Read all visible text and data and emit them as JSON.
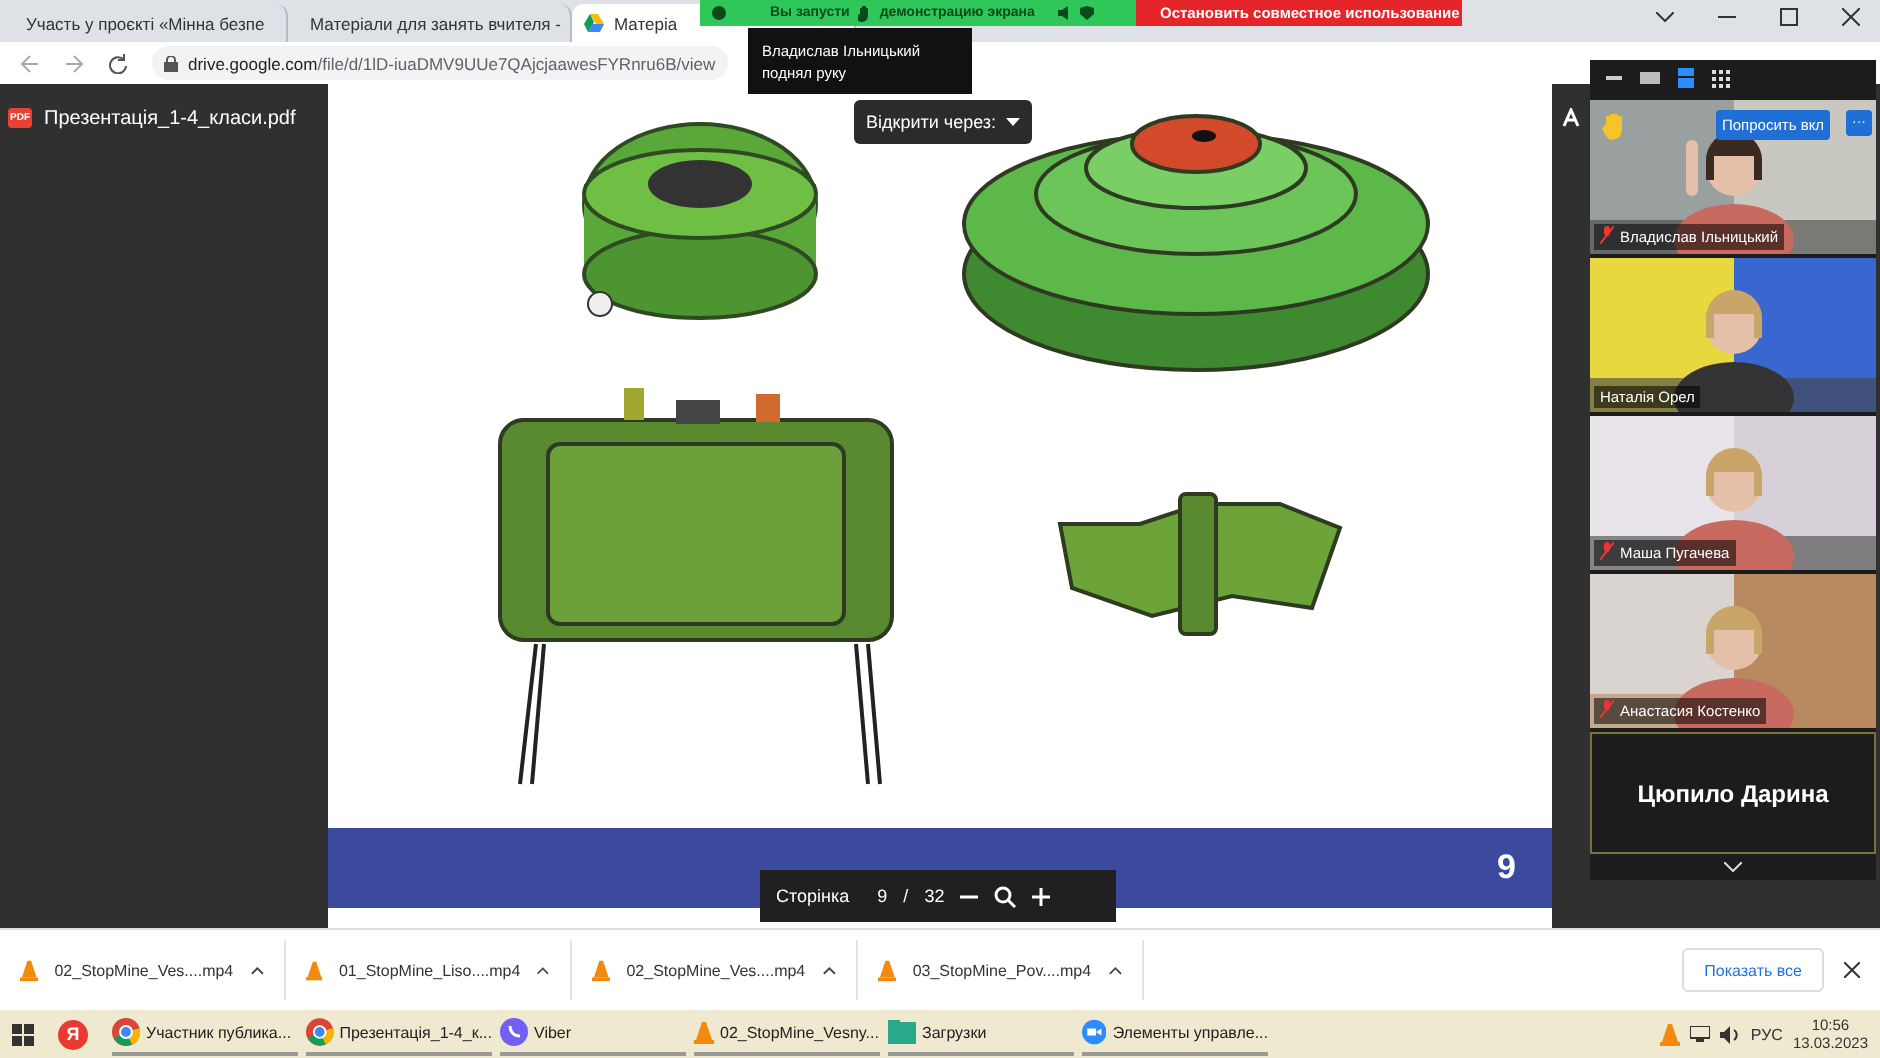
{
  "browser": {
    "tabs": [
      {
        "title": "Участь у проєкті «Мінна безпе",
        "kind": "mail",
        "selected": false
      },
      {
        "title": "Матеріали для занять вчителя -",
        "kind": "drive",
        "selected": false
      },
      {
        "title": "Матеріа",
        "kind": "drive",
        "selected": true
      }
    ],
    "url_domain": "drive.google.com",
    "url_path": "/file/d/1lD-iuaDMV9UUe7QAjcjaawesFYRnru6B/view"
  },
  "sharing_bar": {
    "message_start": "Вы запусти",
    "message_end": "демонстрацию экрана",
    "stop": "Остановить совместное использование"
  },
  "tooltip": "Владислав Ільницький поднял руку",
  "viewer": {
    "file_badge": "PDF",
    "file_name": "Презентація_1-4_класи.pdf",
    "open_with": "Відкрити через:",
    "slide_number": "9",
    "page_label": "Сторінка",
    "page": "9",
    "separator": "/",
    "total": "32"
  },
  "meeting": {
    "ask_button": "Попросить вкл",
    "more_button": "···",
    "participants": [
      {
        "name": "Владислав Ільницький",
        "muted": true,
        "kind": "video"
      },
      {
        "name": "Наталія Орел",
        "muted": false,
        "kind": "video"
      },
      {
        "name": "Маша Пугачева",
        "muted": true,
        "kind": "video"
      },
      {
        "name": "Анастасия Костенко",
        "muted": true,
        "kind": "video"
      },
      {
        "name": "Цюпило Дарина",
        "muted": false,
        "kind": "name_only"
      }
    ]
  },
  "downloads": {
    "files": [
      "02_StopMine_Ves....mp4",
      "01_StopMine_Liso....mp4",
      "02_StopMine_Ves....mp4",
      "03_StopMine_Pov....mp4"
    ],
    "show_all": "Показать все"
  },
  "taskbar": {
    "yandex_glyph": "Я",
    "items": [
      {
        "label": "Участник публика...",
        "kind": "chrome"
      },
      {
        "label": "Презентація_1-4_к...",
        "kind": "chrome"
      },
      {
        "label": "Viber",
        "kind": "viber"
      },
      {
        "label": "02_StopMine_Vesny...",
        "kind": "vlc"
      },
      {
        "label": "Загрузки",
        "kind": "folder"
      },
      {
        "label": "Элементы управле...",
        "kind": "zoom"
      }
    ],
    "language": "РУС",
    "time": "10:56",
    "date": "13.03.2023"
  }
}
